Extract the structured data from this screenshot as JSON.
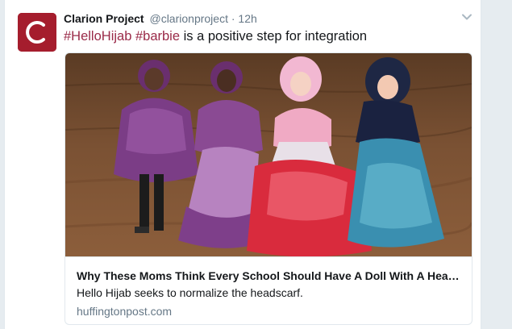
{
  "tweet": {
    "author_name": "Clarion Project",
    "author_handle": "@clarionproject",
    "separator": "·",
    "time": "12h",
    "avatar_letter": "C",
    "hashtag_1": "#HelloHijab",
    "hashtag_2": "#barbie",
    "text_rest": " is a positive step for integration",
    "menu_icon": "chevron-down-icon"
  },
  "card": {
    "image_desc": "four-dolls-wearing-hijabs-photo",
    "title": "Why These Moms Think Every School Should Have A Doll With A Headscarf",
    "description": "Hello Hijab seeks to normalize the headscarf.",
    "domain": "huffingtonpost.com"
  },
  "colors": {
    "brand": "#a51d2d",
    "hashtag": "#9a2a48",
    "muted": "#657786",
    "text": "#14171a",
    "background": "#e6ecf0"
  }
}
